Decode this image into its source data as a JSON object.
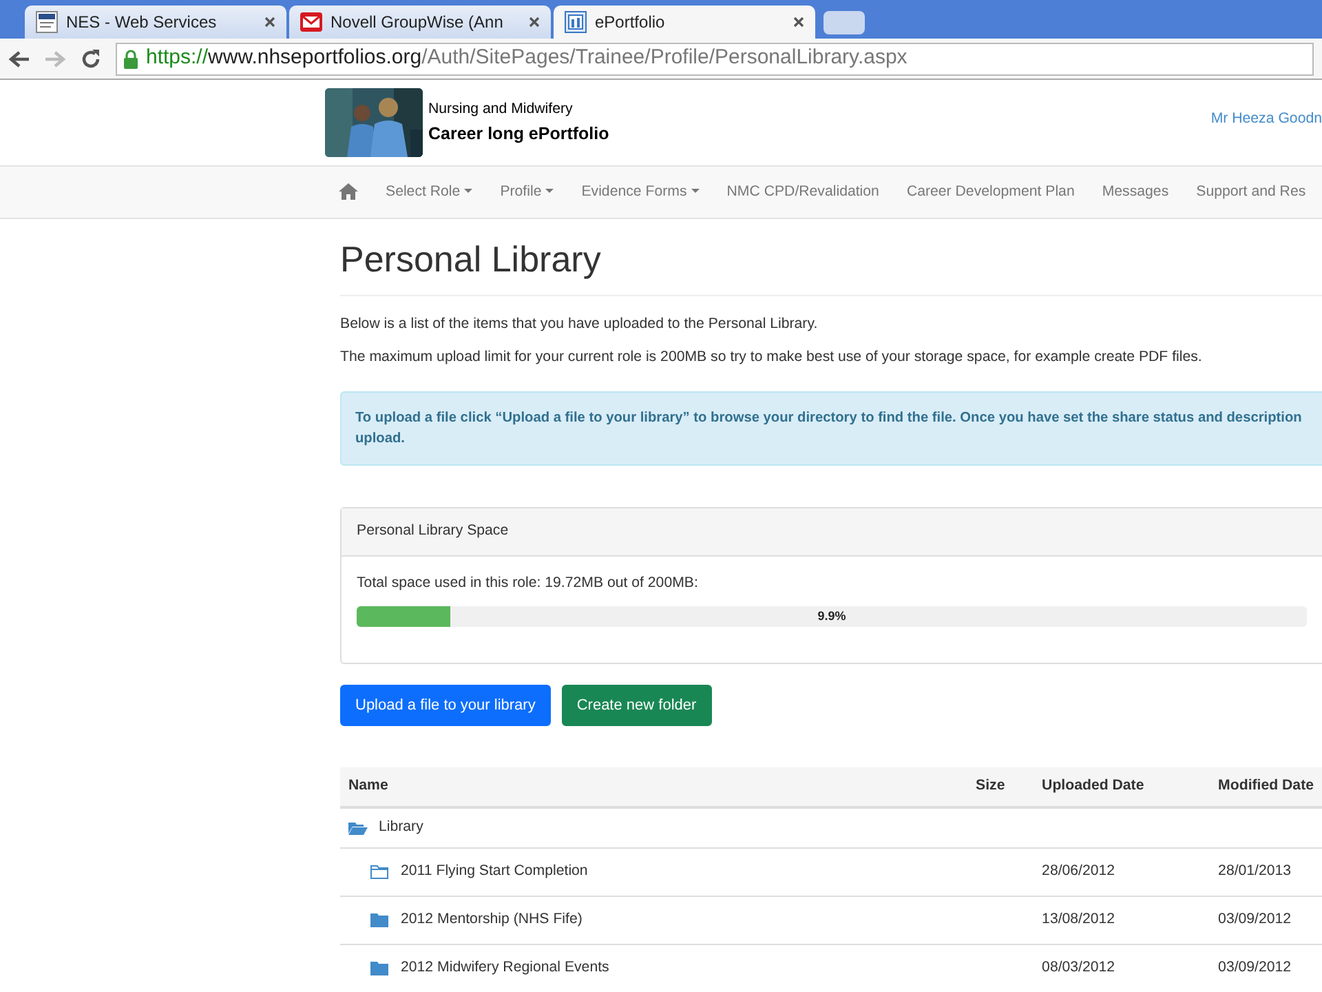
{
  "browser": {
    "tabs": [
      {
        "title": "NES - Web Services",
        "selected": false
      },
      {
        "title": "Novell GroupWise (Ann",
        "selected": false
      },
      {
        "title": "ePortfolio",
        "selected": true
      }
    ],
    "url": {
      "scheme": "https://",
      "domain": "www.nhseportfolios.org",
      "path": "/Auth/SitePages/Trainee/Profile/PersonalLibrary.aspx"
    }
  },
  "header": {
    "subtitle": "Nursing and Midwifery",
    "title": "Career long ePortfolio",
    "user": "Mr Heeza Goodn"
  },
  "nav": [
    {
      "label": "Select Role",
      "dropdown": true
    },
    {
      "label": "Profile",
      "dropdown": true
    },
    {
      "label": "Evidence Forms",
      "dropdown": true
    },
    {
      "label": "NMC CPD/Revalidation",
      "dropdown": false
    },
    {
      "label": "Career Development Plan",
      "dropdown": false
    },
    {
      "label": "Messages",
      "dropdown": false
    },
    {
      "label": "Support and Res",
      "dropdown": false
    }
  ],
  "page_title": "Personal Library",
  "intro": [
    "Below is a list of the items that you have uploaded to the Personal Library.",
    "The maximum upload limit for your current role is 200MB so try to make best use of your storage space, for example create PDF files."
  ],
  "alert": [
    "To upload a file click “Upload a file to your library” to browse your directory to find the file. Once you have set the share status and description",
    "upload."
  ],
  "space_panel": {
    "heading": "Personal Library Space",
    "usage": "Total space used in this role: 19.72MB out of 200MB:",
    "level": 0.099,
    "reading": "9.9%"
  },
  "buttons": [
    {
      "label": "Upload a file to your library",
      "kind": "primary"
    },
    {
      "label": "Create new folder",
      "kind": "success"
    }
  ],
  "table": {
    "columns": [
      "Name",
      "Size",
      "Uploaded Date",
      "Modified Date"
    ],
    "rows": [
      {
        "name": "Library",
        "kind": "open-folder",
        "uploaded": "",
        "modified": "",
        "children": [
          {
            "name": "2011 Flying Start Completion",
            "kind": "empty-folder",
            "uploaded": "28/06/2012",
            "modified": "28/01/2013"
          },
          {
            "name": "2012 Mentorship (NHS Fife)",
            "kind": "folder",
            "uploaded": "13/08/2012",
            "modified": "03/09/2012"
          },
          {
            "name": "2012 Midwifery Regional Events",
            "kind": "folder",
            "uploaded": "08/03/2012",
            "modified": "03/09/2012"
          }
        ]
      }
    ]
  }
}
